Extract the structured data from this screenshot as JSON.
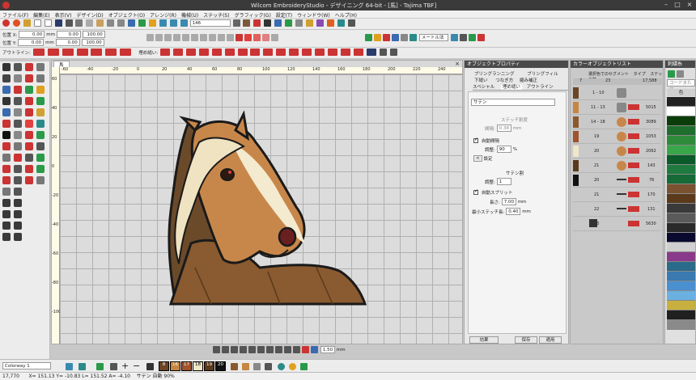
{
  "window": {
    "title": "Wilcom EmbroideryStudio - デザイニング 64-bit - [馬] - Tajima TBF]"
  },
  "menu": [
    "ファイル(F)",
    "編集(E)",
    "表示(V)",
    "デザイン(D)",
    "オブジェクト(O)",
    "アレンジ(R)",
    "機械(U)",
    "ステッチ(S)",
    "グラフィック(G)",
    "設定(T)",
    "ウィンドウ(W)",
    "ヘルプ(H)"
  ],
  "toolbar": {
    "pos_x_label": "位置 X:",
    "pos_x_value": "0.00",
    "pos_x_unit": "mm",
    "pos_y_label": "位置 Y:",
    "pos_y_value": "0.00",
    "pos_y_unit": "mm",
    "width_value": "0.00",
    "height_value": "0.00",
    "percent1": "100.00",
    "percent2": "100.00",
    "zoom_value": "146",
    "measure_label": "メートル法",
    "outline_label": "アウトライン:",
    "fill_label": "埋め縫い:"
  },
  "tab": "馬",
  "ruler_h": [
    "-60",
    "-40",
    "-20",
    "0",
    "20",
    "40",
    "60",
    "80",
    "100",
    "120",
    "140",
    "160",
    "180",
    "200",
    "220",
    "240"
  ],
  "ruler_v": [
    "60",
    "40",
    "20",
    "0",
    "-20",
    "-40",
    "-60",
    "-80",
    "-100"
  ],
  "object_properties": {
    "title": "オブジェクトプロパティ",
    "tabs_row1": [
      "ブリングランニング",
      "ブリングフィル"
    ],
    "tabs_row2": [
      "下縫い",
      "つなぎ方",
      "縮み補正"
    ],
    "tabs_row3": [
      "スペシャル",
      "埋め縫い",
      "アウトライン"
    ],
    "fill_type": "サテン",
    "stitch_spacing": "ステッチ割度",
    "spacing_label": "間隔:",
    "spacing_value": "0.38",
    "spacing_unit": "mm",
    "auto_spacing_label": "自動間隔",
    "adjust_label": "調整:",
    "adjust_value": "90",
    "adjust_unit": "%",
    "settings_label": "設定",
    "satin_split_heading": "サテン割",
    "satin_adjust_label": "調整:",
    "satin_adjust_value": "1",
    "auto_split_label": "自動スプリット",
    "length_label": "長さ:",
    "length_value": "7.00",
    "length_unit": "mm",
    "min_stitch_label": "最小ステッチ長:",
    "min_stitch_value": "0.40",
    "min_stitch_unit": "mm",
    "effect_button": "効果",
    "save_button": "保存",
    "apply_button": "適用"
  },
  "color_object_list": {
    "title": "カラーオブジェクトリスト",
    "header": [
      "選択色でのセグメント",
      "タイプ",
      "ステッチ数"
    ],
    "total_row": {
      "num": "7",
      "count": "23",
      "stitches": "17,588"
    },
    "rows": [
      {
        "range": "1 - 10",
        "stitches": "",
        "color": "#6b4423"
      },
      {
        "range": "11 - 13",
        "stitches": "5015",
        "color": "#c68642"
      },
      {
        "range": "14 - 18",
        "stitches": "3089",
        "color": "#8a5a2b"
      },
      {
        "range": "19",
        "stitches": "1053",
        "color": "#a0522d"
      },
      {
        "range": "20",
        "stitches": "2062",
        "color": "#f0e6c8"
      },
      {
        "range": "21",
        "stitches": "143",
        "color": "#5a3a1a"
      },
      {
        "range": "20",
        "stitches": "76",
        "color": "#111111"
      },
      {
        "range": "21",
        "stitches": "170",
        "color": "#111111"
      },
      {
        "range": "22",
        "stitches": "131",
        "color": "#111111"
      },
      {
        "range": "23",
        "stitches": "5630",
        "color": "#111111"
      }
    ]
  },
  "palette": {
    "title": "刺繍糸",
    "search_placeholder": "コードまたは",
    "color_label": "色",
    "colors": [
      "#222222",
      "#ffffff",
      "#0b3d0b",
      "#1f6e2e",
      "#2e8b3a",
      "#3aa64a",
      "#0a5a2a",
      "#1e7a3e",
      "#156a36",
      "#7a5230",
      "#5a3a1a",
      "#3a3a3a",
      "#5a5a5a",
      "#2a2a2a",
      "#0a0a30",
      "#d0d0d0",
      "#8a3a8a",
      "#2a6a8a",
      "#3a7ab0",
      "#4a90d0",
      "#6ab0e0",
      "#c8b040",
      "#202020",
      "#8a8a8a"
    ]
  },
  "bottom": {
    "colorway": "Colorway 1",
    "zoom_field": "1.50",
    "zoom_unit": "mm",
    "swatches": [
      {
        "n": "8",
        "c": "#6b4423"
      },
      {
        "n": "16",
        "c": "#c68642"
      },
      {
        "n": "17",
        "c": "#a0522d"
      },
      {
        "n": "18",
        "c": "#f0e6c8"
      },
      {
        "n": "19",
        "c": "#5a3a1a"
      },
      {
        "n": "20",
        "c": "#111111"
      }
    ]
  },
  "status": "17,770      X= 151.13 Y= -10.83 L= 151.52 A= -4.10    サテン 自動 90%"
}
